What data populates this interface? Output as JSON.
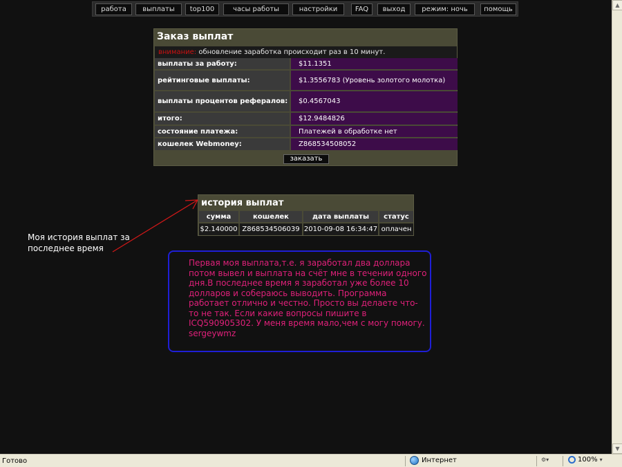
{
  "nav": {
    "items": [
      "работа",
      "выплаты",
      "top100",
      "часы работы",
      "настройки",
      "FAQ",
      "выход",
      "режим: ночь",
      "помощь"
    ]
  },
  "order": {
    "title": "Заказ выплат",
    "notice_warn": "внимание:",
    "notice_text": " обновление заработка происходит раз в 10 минут.",
    "rows": [
      {
        "label": "выплаты за работу:",
        "value": "$11.1351"
      },
      {
        "label": "рейтинговые выплаты:",
        "value": "$1.3556783 (Уровень золотого молотка)"
      },
      {
        "label": "выплаты процентов рефералов:",
        "value": "$0.4567043"
      },
      {
        "label": "итого:",
        "value": "$12.9484826"
      },
      {
        "label": "состояние платежа:",
        "value": "Платежей в обработке нет"
      },
      {
        "label": "кошелек Webmoney:",
        "value": "Z868534508052"
      }
    ],
    "button": "заказать"
  },
  "history": {
    "title": "история выплат",
    "headers": [
      "сумма",
      "кошелек",
      "дата выплаты",
      "статус"
    ],
    "row": [
      "$2.140000",
      "Z868534506039",
      "2010-09-08 16:34:47",
      "оплачен"
    ]
  },
  "annotation": {
    "label": "Моя история выплат за последнее время",
    "note": "Первая моя выплата,т.е. я заработал два доллара потом вывел и выплата на счёт мне в течении одного дня.В последнее время я заработал уже более 10 долларов и собераюсь  выводить. Программа работает отлично и честно. Просто вы делаете что-то не так. Если какие вопросы пишите в ICQ590905302. У меня время мало,чем с могу помогу.",
    "signature": "sergeywmz"
  },
  "statusbar": {
    "status": "Готово",
    "zone": "Интернет",
    "zoom": "100%"
  },
  "colors": {
    "background": "#111111",
    "panel": "#4a4a36",
    "value_cell": "#3d0c49",
    "warning": "#cc1111",
    "note_text": "#e0207a",
    "note_border": "#1f1fd6",
    "arrow": "#d01818"
  }
}
